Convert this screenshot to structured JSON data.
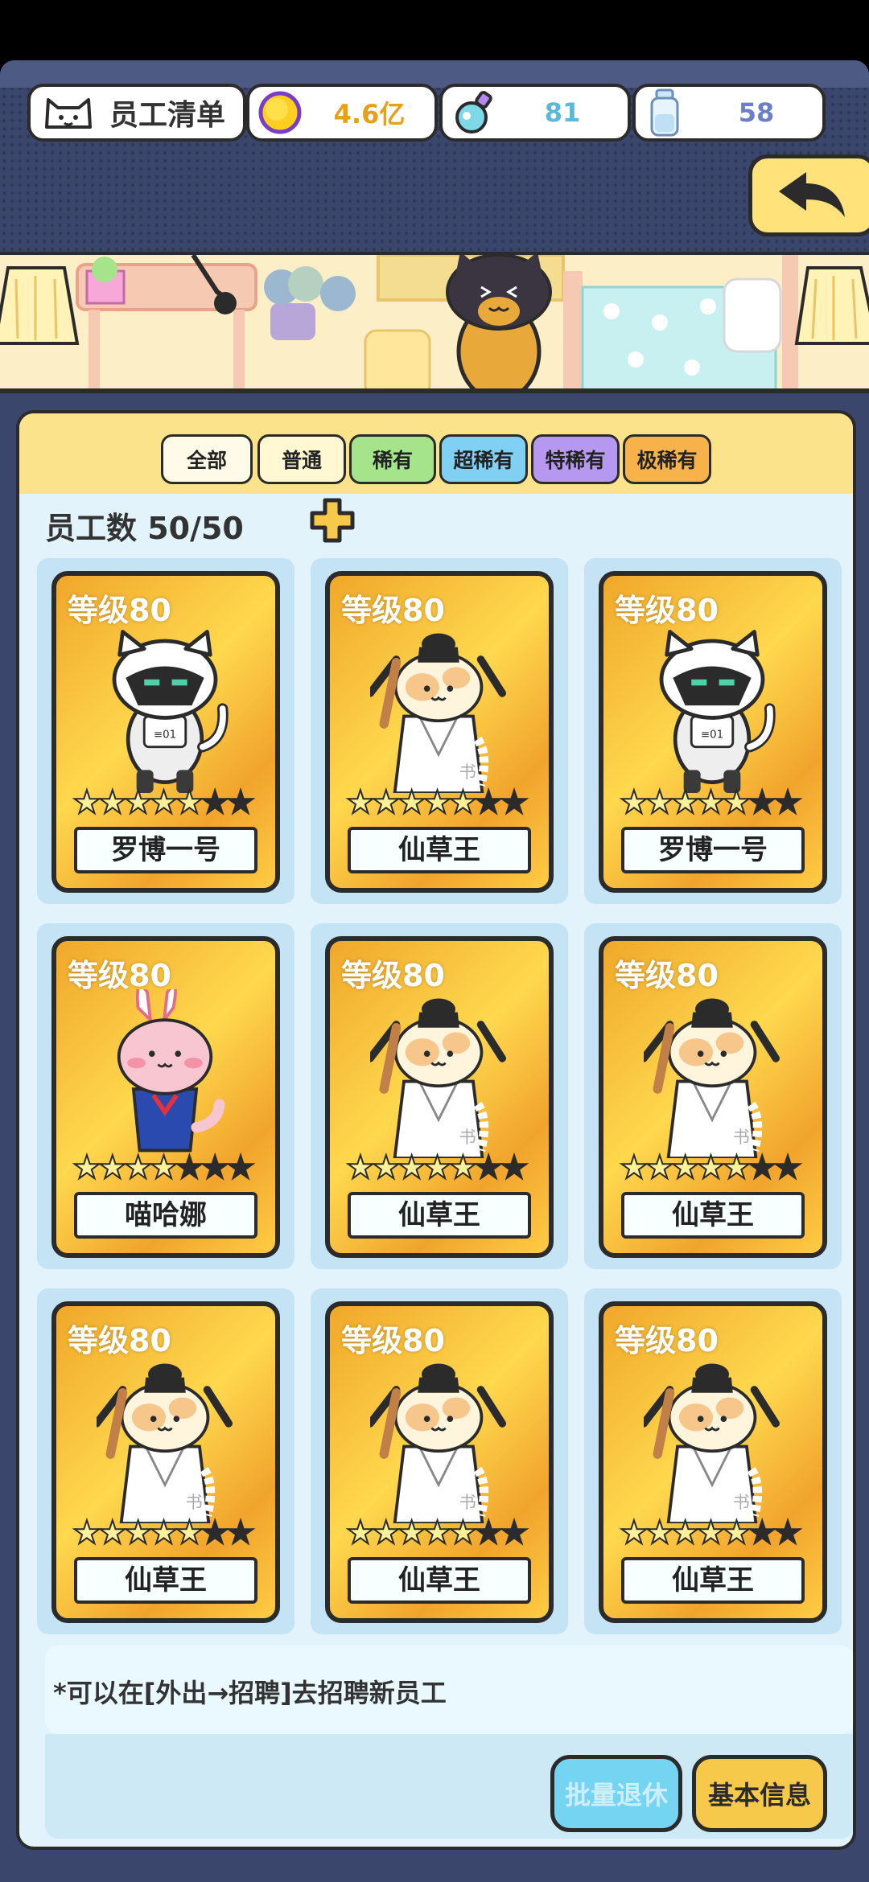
{
  "header": {
    "title": "员工清单",
    "coins": "4.6亿",
    "potion": "81",
    "bottle": "58"
  },
  "tabs": [
    {
      "label": "全部",
      "color": "#fffbe8"
    },
    {
      "label": "普通",
      "color": "#fff8d2"
    },
    {
      "label": "稀有",
      "color": "#a6e48c"
    },
    {
      "label": "超稀有",
      "color": "#7fd0f2"
    },
    {
      "label": "特稀有",
      "color": "#b698f0"
    },
    {
      "label": "极稀有",
      "color": "#f7b24a"
    }
  ],
  "staff_count": "员工数 50/50",
  "cards": [
    {
      "level": "等级80",
      "name": "罗博一号",
      "type": "robot",
      "stars_filled": 5,
      "stars_total": 7
    },
    {
      "level": "等级80",
      "name": "仙草王",
      "type": "scholar",
      "stars_filled": 5,
      "stars_total": 7
    },
    {
      "level": "等级80",
      "name": "罗博一号",
      "type": "robot",
      "stars_filled": 5,
      "stars_total": 7
    },
    {
      "level": "等级80",
      "name": "喵哈娜",
      "type": "bunny",
      "stars_filled": 4,
      "stars_total": 7
    },
    {
      "level": "等级80",
      "name": "仙草王",
      "type": "scholar",
      "stars_filled": 5,
      "stars_total": 7
    },
    {
      "level": "等级80",
      "name": "仙草王",
      "type": "scholar",
      "stars_filled": 5,
      "stars_total": 7
    },
    {
      "level": "等级80",
      "name": "仙草王",
      "type": "scholar",
      "stars_filled": 5,
      "stars_total": 7
    },
    {
      "level": "等级80",
      "name": "仙草王",
      "type": "scholar",
      "stars_filled": 5,
      "stars_total": 7
    },
    {
      "level": "等级80",
      "name": "仙草王",
      "type": "scholar",
      "stars_filled": 5,
      "stars_total": 7
    }
  ],
  "hint": "*可以在[外出→招聘]去招聘新员工",
  "buttons": {
    "batch_retire": "批量退休",
    "basic_info": "基本信息"
  },
  "colors": {
    "coins": "#e8a018",
    "potion": "#5ab8d8",
    "bottle": "#6b7fc8"
  }
}
